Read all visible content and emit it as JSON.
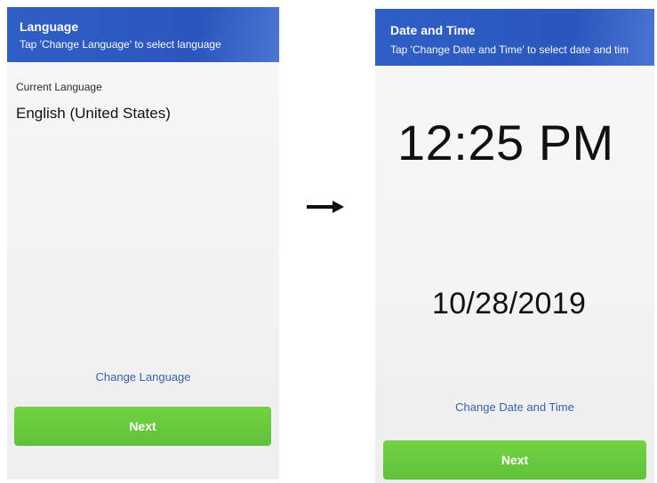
{
  "left_screen": {
    "header": {
      "title": "Language",
      "subtitle": "Tap 'Change Language' to select language"
    },
    "current_label": "Current Language",
    "current_value": "English (United States)",
    "change_link": "Change Language",
    "next_label": "Next"
  },
  "right_screen": {
    "header": {
      "title": "Date and Time",
      "subtitle": "Tap 'Change Date and Time' to select date and tim"
    },
    "time": "12:25 PM",
    "date": "10/28/2019",
    "change_link": "Change Date and Time",
    "next_label": "Next"
  },
  "colors": {
    "header_blue": "#2b56bd",
    "link_blue": "#3860b5",
    "next_green": "#66c63b"
  },
  "icons": {
    "transition_arrow": "right-arrow-icon"
  }
}
